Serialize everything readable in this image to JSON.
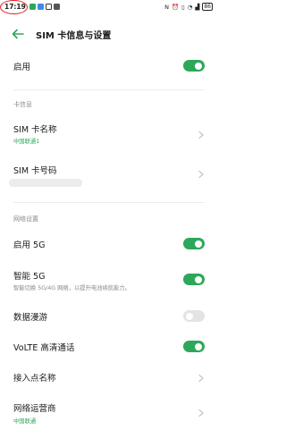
{
  "status_bar": {
    "time": "17:19",
    "battery": "86"
  },
  "header": {
    "title": "SIM 卡信息与设置"
  },
  "enable": {
    "label": "启用",
    "toggle_on": true
  },
  "sim_info": {
    "section_label": "卡信息",
    "sim_name_label": "SIM 卡名称",
    "sim_name_value": "中国联通1",
    "sim_number_label": "SIM 卡号码"
  },
  "network": {
    "section_label": "网络设置",
    "enable_5g_label": "启用 5G",
    "enable_5g_on": true,
    "smart_5g_label": "智能 5G",
    "smart_5g_desc": "智能切换 5G/4G 网络，以提升电池续航能力。",
    "smart_5g_on": true,
    "roaming_label": "数据漫游",
    "roaming_on": false,
    "volte_label": "VoLTE 高清通话",
    "volte_on": true,
    "apn_label": "接入点名称",
    "operator_label": "网络运营商",
    "operator_value": "中国联通"
  },
  "colors": {
    "accent": "#2da85a",
    "toggle_off": "#e3e3e3",
    "annotation": "#e02020"
  }
}
